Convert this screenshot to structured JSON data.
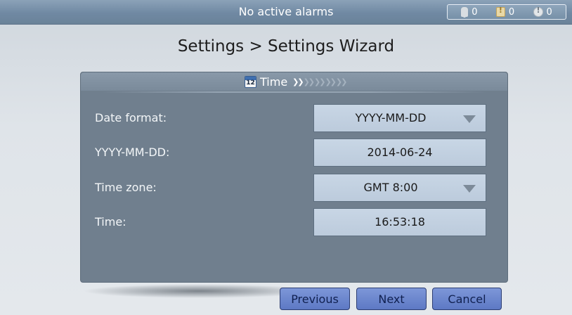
{
  "status_bar": {
    "message": "No active alarms",
    "counters": [
      {
        "icon": "bell-icon",
        "count": "0"
      },
      {
        "icon": "warning-icon",
        "count": "0"
      },
      {
        "icon": "alert-circle-icon",
        "count": "0"
      }
    ]
  },
  "page": {
    "title": "Settings > Settings Wizard"
  },
  "wizard": {
    "step_title": "Time",
    "step_icon": "calendar-icon",
    "step_icon_text": "12",
    "steps_total": 5,
    "current_step": 1,
    "fields": {
      "date_format": {
        "label": "Date format:",
        "value": "YYYY-MM-DD"
      },
      "date": {
        "label": "YYYY-MM-DD:",
        "value": "2014-06-24"
      },
      "time_zone": {
        "label": "Time zone:",
        "value": "GMT 8:00"
      },
      "time": {
        "label": "Time:",
        "value": "16:53:18"
      }
    }
  },
  "buttons": {
    "previous": "Previous",
    "next": "Next",
    "cancel": "Cancel"
  },
  "colors": {
    "topbar": "#7089a3",
    "panel": "#707f8e",
    "field": "#c4d2e1",
    "button": "#6b86ce"
  }
}
